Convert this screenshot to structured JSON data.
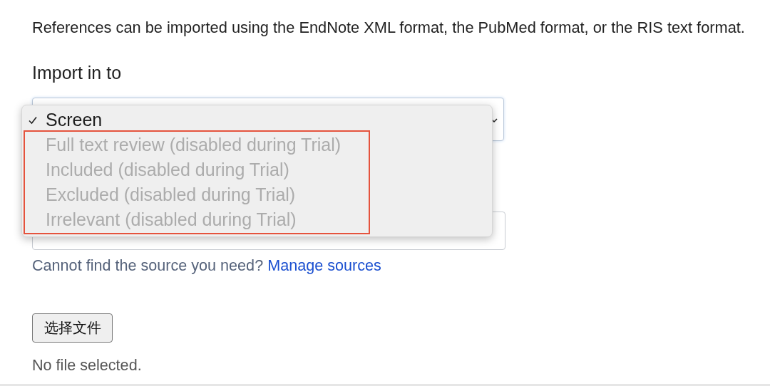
{
  "intro": "References can be imported using the EndNote XML format, the PubMed format, or the RIS text format.",
  "import_label": "Import in to",
  "import_select": {
    "expanded": true,
    "options": [
      {
        "label": "Screen",
        "selected": true,
        "disabled": false,
        "highlighted": false
      },
      {
        "label": "Full text review (disabled during Trial)",
        "selected": false,
        "disabled": true,
        "highlighted": true
      },
      {
        "label": "Included (disabled during Trial)",
        "selected": false,
        "disabled": true,
        "highlighted": true
      },
      {
        "label": "Excluded (disabled during Trial)",
        "selected": false,
        "disabled": true,
        "highlighted": true
      },
      {
        "label": "Irrelevant (disabled during Trial)",
        "selected": false,
        "disabled": true,
        "highlighted": true
      }
    ]
  },
  "source_hint": {
    "text": "Cannot find the source you need?",
    "link": "Manage sources"
  },
  "file_button": "选择文件",
  "file_status": "No file selected."
}
